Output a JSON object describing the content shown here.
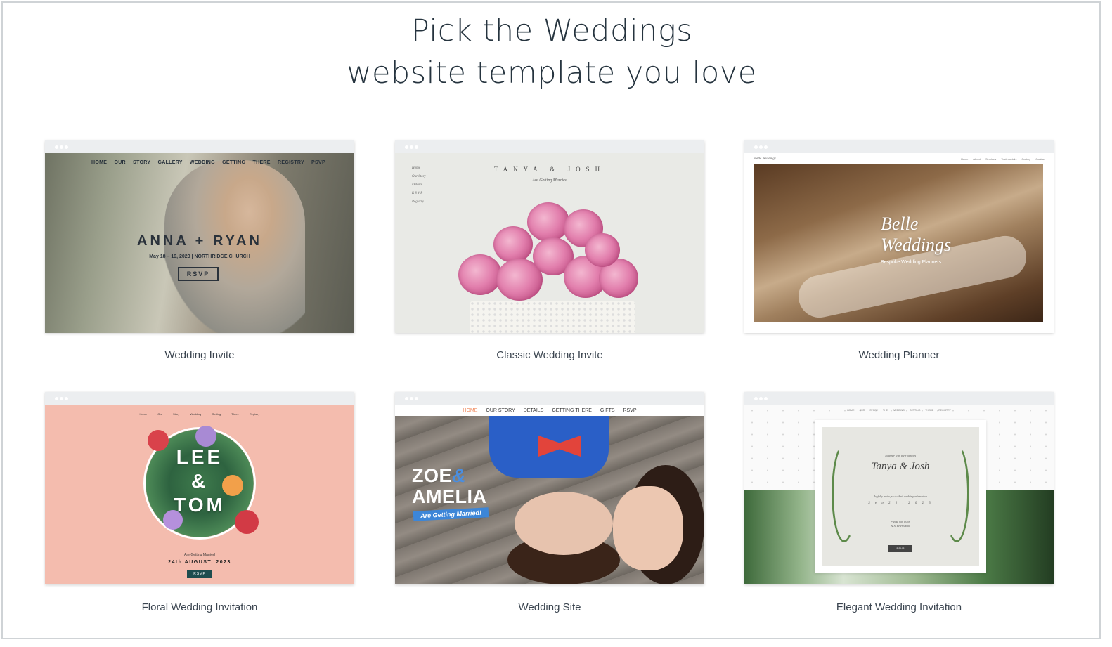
{
  "heading": {
    "line1": "Pick the Weddings",
    "line2": "website template you love"
  },
  "templates": [
    {
      "caption": "Wedding Invite",
      "preview": {
        "nav": "HOME OUR STORY GALLERY WEDDING GETTING THERE REGISTRY PSVP",
        "names": "ANNA + RYAN",
        "date": "May 18 – 19, 2023 | NORTHRIDGE CHURCH",
        "button": "RSVP"
      }
    },
    {
      "caption": "Classic Wedding Invite",
      "preview": {
        "couple": "TANYA & JOSH",
        "subtitle": "Are Getting Married",
        "menu": [
          "Home",
          "Our Story",
          "Details",
          "R S V P",
          "Registry"
        ]
      }
    },
    {
      "caption": "Wedding Planner",
      "preview": {
        "logo": "Belle Weddings",
        "menu": "Home About Services Testimonials Gallery Contact",
        "title_line1": "Belle",
        "title_line2": "Weddings",
        "tagline": "Bespoke Wedding Planners"
      }
    },
    {
      "caption": "Floral Wedding Invitation",
      "preview": {
        "nav": "Home Our Story Wedding Getting There Registry",
        "name1": "LEE",
        "amp": "&",
        "name2": "TOM",
        "married": "Are Getting Married",
        "date": "24th AUGUST, 2023",
        "button": "RSVP"
      }
    },
    {
      "caption": "Wedding Site",
      "preview": {
        "nav": [
          "HOME",
          "OUR STORY",
          "DETAILS",
          "GETTING THERE",
          "GIFTS",
          "RSVP"
        ],
        "name1": "ZOE",
        "amp": "&",
        "name2": "AMELIA",
        "banner": "Are Getting Married!"
      }
    },
    {
      "caption": "Elegant Wedding Invitation",
      "preview": {
        "nav": "HOME OUR STORY THE WEDDING GETTING THERE REGISTRY",
        "together": "Together with their families",
        "names": "Tanya & Josh",
        "invite": "Joyfully invite you to their wedding celebration",
        "date": "S e p 2 1 , 2 0 2 3",
        "reply_line1": "Please join us on",
        "reply_line2": "At St Peter's Hall",
        "button": "RSVP"
      }
    }
  ]
}
